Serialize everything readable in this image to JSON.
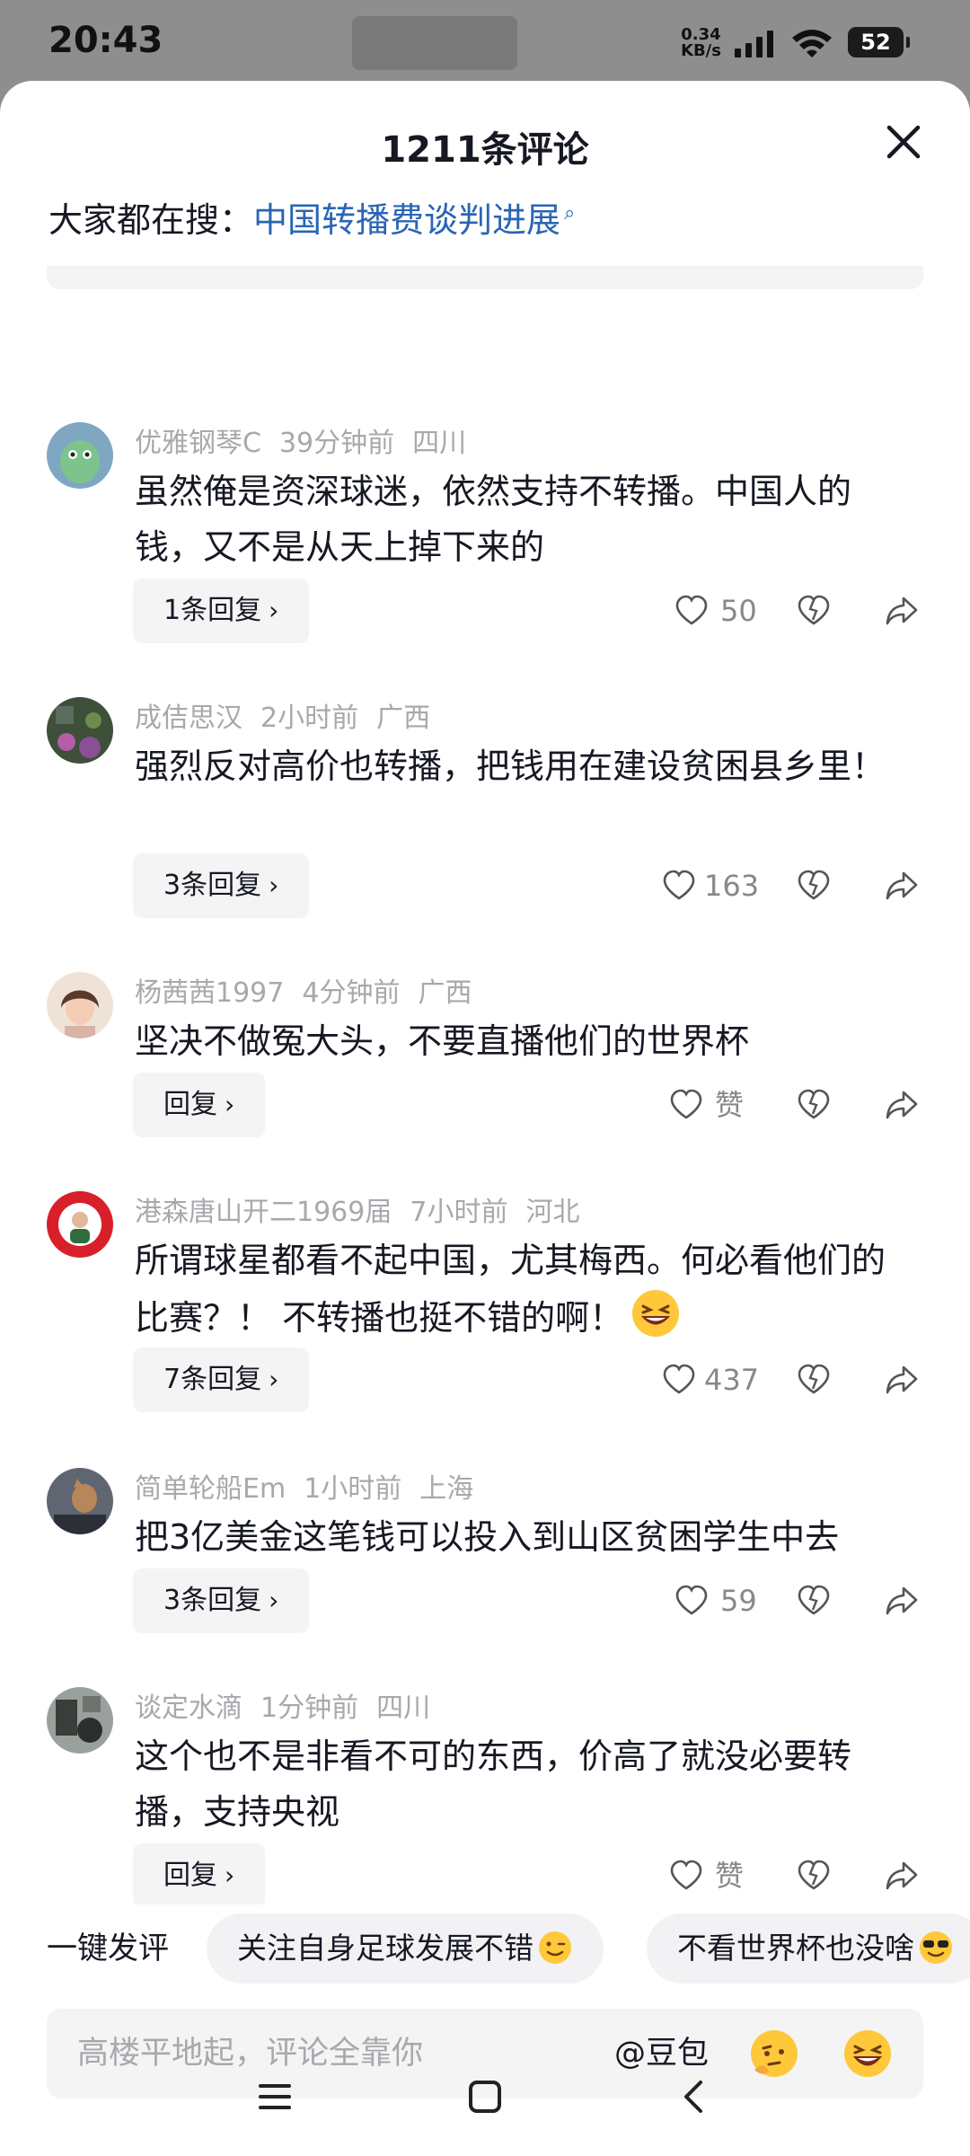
{
  "status": {
    "time": "20:43",
    "net_speed_value": "0.34",
    "net_speed_unit": "KB/s",
    "battery": "52"
  },
  "header": {
    "title": "1211条评论"
  },
  "hot_search": {
    "label": "大家都在搜：",
    "query": "中国转播费谈判进展"
  },
  "comments": [
    {
      "user": "优雅钢琴C",
      "time": "39分钟前",
      "location": "四川",
      "text": "虽然俺是资深球迷，依然支持不转播。中国人的钱，又不是从天上掉下来的",
      "reply_label": "1条回复",
      "likes": "50"
    },
    {
      "user": "成佶思汉",
      "time": "2小时前",
      "location": "广西",
      "text": "强烈反对高价也转播，把钱用在建设贫困县乡里！",
      "reply_label": "3条回复",
      "likes": "163"
    },
    {
      "user": "杨茜茜1997",
      "time": "4分钟前",
      "location": "广西",
      "text": "坚决不做冤大头，不要直播他们的世界杯",
      "reply_label": "回复",
      "likes": "赞"
    },
    {
      "user": "港森唐山开二1969届",
      "time": "7小时前",
      "location": "河北",
      "text": "所谓球星都看不起中国，尤其梅西。何必看他们的比赛？！ 不转播也挺不错的啊！",
      "reply_label": "7条回复",
      "likes": "437"
    },
    {
      "user": "简单轮船Em",
      "time": "1小时前",
      "location": "上海",
      "text": "把3亿美金这笔钱可以投入到山区贫困学生中去",
      "reply_label": "3条回复",
      "likes": "59"
    },
    {
      "user": "谈定水滴",
      "time": "1分钟前",
      "location": "四川",
      "text": "这个也不是非看不可的东西，价高了就没必要转播，支持央视",
      "reply_label": "回复",
      "likes": "赞"
    }
  ],
  "quick_reply": {
    "label": "一键发评",
    "chips": [
      "关注自身足球发展不错",
      "不看世界杯也没啥"
    ]
  },
  "input": {
    "placeholder": "高楼平地起，评论全靠你",
    "at_label": "@豆包"
  },
  "colors": {
    "link": "#2a65b4",
    "meta": "#a8a8ad",
    "chip_bg": "#f2f2f4"
  }
}
